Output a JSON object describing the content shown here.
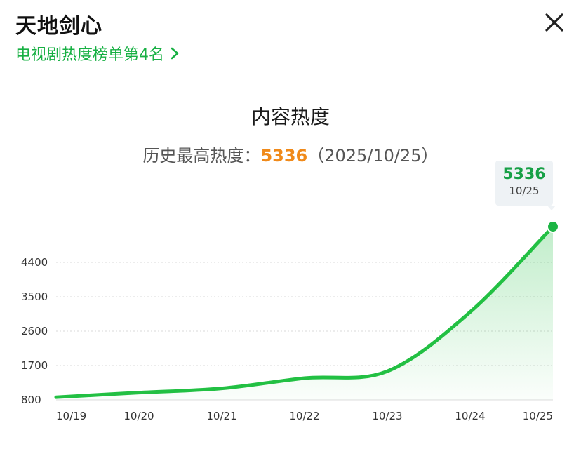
{
  "header": {
    "title": "天地剑心",
    "rank_label": "电视剧热度榜单第4名"
  },
  "section": {
    "title": "内容热度",
    "history_prefix": "历史最高热度：",
    "history_peak": "5336",
    "history_date": "（2025/10/25）"
  },
  "tooltip": {
    "value": "5336",
    "date": "10/25"
  },
  "colors": {
    "accent": "#17b043",
    "peak": "#f08a1a",
    "line": "#22c043"
  },
  "chart_data": {
    "type": "area",
    "x": [
      "10/19",
      "10/20",
      "10/21",
      "10/22",
      "10/23",
      "10/24",
      "10/25"
    ],
    "values": [
      870,
      990,
      1100,
      1370,
      1550,
      3100,
      5336
    ],
    "yticks": [
      800,
      1700,
      2600,
      3500,
      4400
    ],
    "ytick_labels": [
      "800",
      "1700",
      "2600",
      "3500",
      "4400"
    ],
    "ylim": [
      800,
      5336
    ],
    "grid": true,
    "smooth": true
  }
}
